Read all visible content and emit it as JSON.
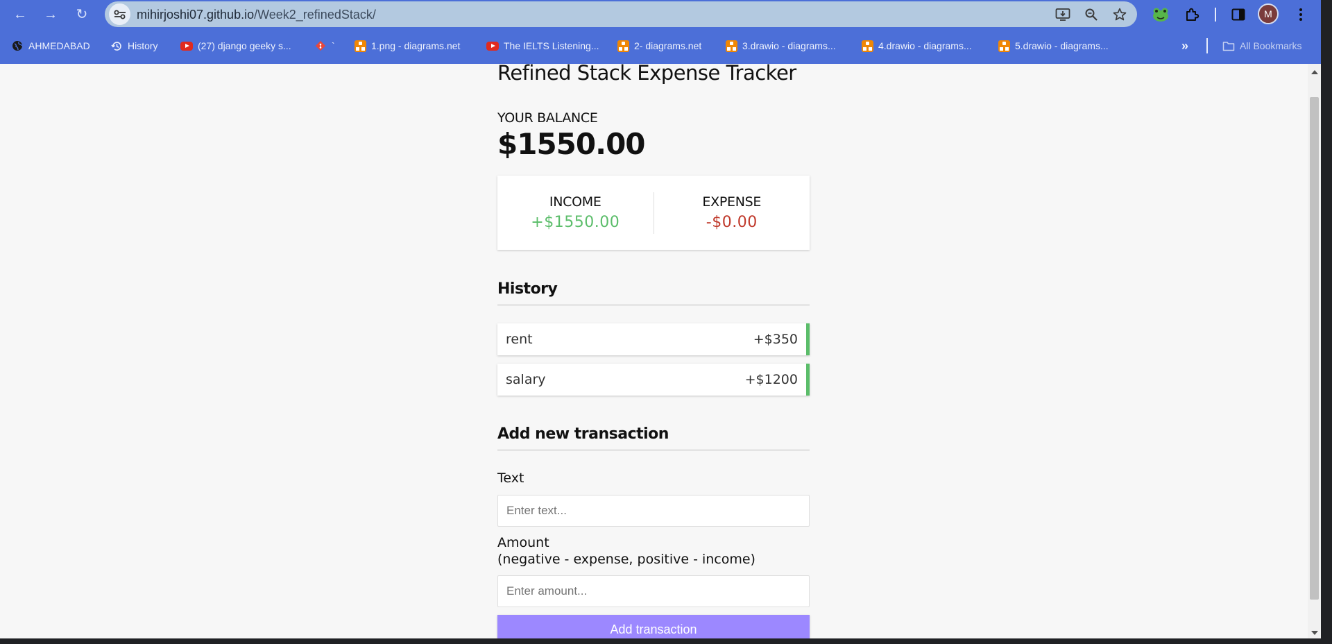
{
  "browser": {
    "url_host": "mihirjoshi07.github.io",
    "url_path": "/Week2_refinedStack/",
    "avatar_letter": "M",
    "bookmarks": [
      {
        "label": "AHMEDABAD",
        "icon": "globe-icon"
      },
      {
        "label": "History",
        "icon": "history-icon"
      },
      {
        "label": "(27) django geeky s...",
        "icon": "youtube-icon"
      },
      {
        "label": "`",
        "icon": "git-icon"
      },
      {
        "label": "1.png - diagrams.net",
        "icon": "drawio-icon"
      },
      {
        "label": "The IELTS Listening...",
        "icon": "youtube-icon"
      },
      {
        "label": "2- diagrams.net",
        "icon": "drawio-icon"
      },
      {
        "label": "3.drawio - diagrams...",
        "icon": "drawio-icon"
      },
      {
        "label": "4.drawio - diagrams...",
        "icon": "drawio-icon"
      },
      {
        "label": "5.drawio - diagrams...",
        "icon": "drawio-icon"
      }
    ],
    "all_bookmarks_label": "All Bookmarks"
  },
  "app": {
    "title": "Refined Stack Expense Tracker",
    "balance_label": "YOUR BALANCE",
    "balance_value": "$1550.00",
    "income_label": "INCOME",
    "income_value": "+$1550.00",
    "expense_label": "EXPENSE",
    "expense_value": "-$0.00",
    "history_title": "History",
    "transactions": [
      {
        "text": "rent",
        "amount": "+$350"
      },
      {
        "text": "salary",
        "amount": "+$1200"
      }
    ],
    "add_title": "Add new transaction",
    "text_label": "Text",
    "text_placeholder": "Enter text...",
    "amount_label": "Amount",
    "amount_hint": "(negative - expense, positive - income)",
    "amount_placeholder": "Enter amount...",
    "submit_label": "Add transaction"
  },
  "colors": {
    "income": "#5bbd6a",
    "expense": "#c0392b",
    "button": "#9c88ff",
    "chrome": "#4c6fd8"
  }
}
